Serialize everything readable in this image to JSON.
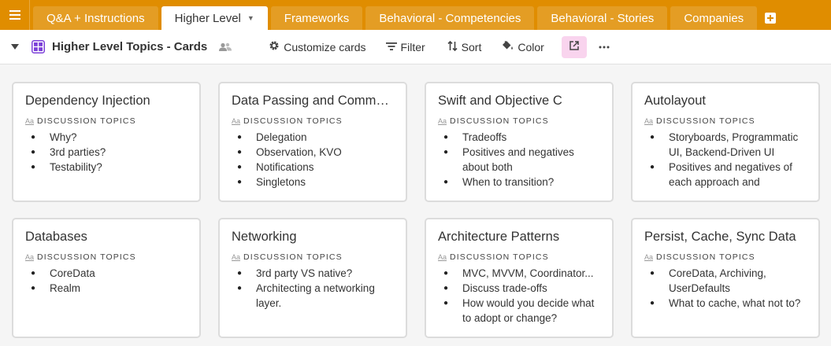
{
  "tabs": [
    {
      "label": "Q&A + Instructions",
      "active": false
    },
    {
      "label": "Higher Level",
      "active": true
    },
    {
      "label": "Frameworks",
      "active": false
    },
    {
      "label": "Behavioral - Competencies",
      "active": false
    },
    {
      "label": "Behavioral - Stories",
      "active": false
    },
    {
      "label": "Companies",
      "active": false
    }
  ],
  "toolbar": {
    "view_name": "Higher Level Topics - Cards",
    "customize_label": "Customize cards",
    "filter_label": "Filter",
    "sort_label": "Sort",
    "color_label": "Color"
  },
  "colors": {
    "tabbar": "#e08d00",
    "view_icon": "#7b3fd8",
    "share_bg": "#f9d4ee"
  },
  "field_label": "DISCUSSION TOPICS",
  "cards": [
    {
      "title": "Dependency Injection",
      "topics": [
        "Why?",
        "3rd parties?",
        "Testability?"
      ]
    },
    {
      "title": "Data Passing and Commu...",
      "topics": [
        "Delegation",
        "Observation, KVO",
        "Notifications",
        "Singletons"
      ]
    },
    {
      "title": "Swift and Objective C",
      "topics": [
        "Tradeoffs",
        "Positives and negatives about both",
        "When to transition?"
      ]
    },
    {
      "title": "Autolayout",
      "topics": [
        "Storyboards, Programmatic UI, Backend-Driven UI",
        "Positives and negatives of each approach  and"
      ]
    },
    {
      "title": "Databases",
      "topics": [
        "CoreData",
        "Realm"
      ]
    },
    {
      "title": "Networking",
      "topics": [
        "3rd party VS native?",
        "Architecting a networking layer."
      ]
    },
    {
      "title": "Architecture Patterns",
      "topics": [
        "MVC, MVVM, Coordinator...",
        "Discuss trade-offs",
        "How would you decide what to adopt or change?"
      ]
    },
    {
      "title": "Persist, Cache, Sync Data",
      "topics": [
        "CoreData, Archiving, UserDefaults",
        "What to cache, what not to?"
      ]
    }
  ]
}
